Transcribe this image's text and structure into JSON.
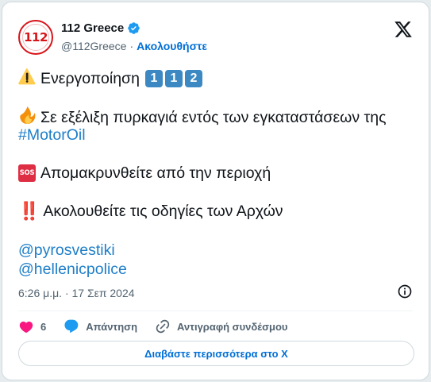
{
  "header": {
    "avatar_logo_text": "112",
    "display_name": "112 Greece",
    "handle": "@112Greece",
    "separator": "·",
    "follow_label": "Ακολουθήστε"
  },
  "tweet": {
    "line1": {
      "emoji": "warning-icon",
      "text": "Ενεργοποίηση",
      "keycaps": [
        "1",
        "1",
        "2"
      ]
    },
    "line2": {
      "emoji": "fire-icon",
      "text": "Σε εξέλιξη πυρκαγιά εντός των εγκαταστάσεων της"
    },
    "hashtag": "#MotorOil",
    "line3": {
      "badge": "SOS",
      "text": "Απομακρυνθείτε από την περιοχή"
    },
    "line4": {
      "emoji": "‼️",
      "text": "Ακολουθείτε τις οδηγίες των Αρχών"
    },
    "mentions": [
      "@pyrosvestiki",
      "@hellenicpolice"
    ]
  },
  "timestamp": "6:26 μ.μ. · 17 Σεπ 2024",
  "actions": {
    "like_count": "6",
    "reply_label": "Απάντηση",
    "copy_link_label": "Αντιγραφή συνδέσμου"
  },
  "read_more_label": "Διαβάστε περισσότερα στο X",
  "colors": {
    "link": "#1d7ec8",
    "follow": "#006fd6",
    "like": "#f91880",
    "reply": "#1d9bf0",
    "verified": "#1d9bf0",
    "keycap": "#3b88c3",
    "sos": "#dd2e44"
  }
}
